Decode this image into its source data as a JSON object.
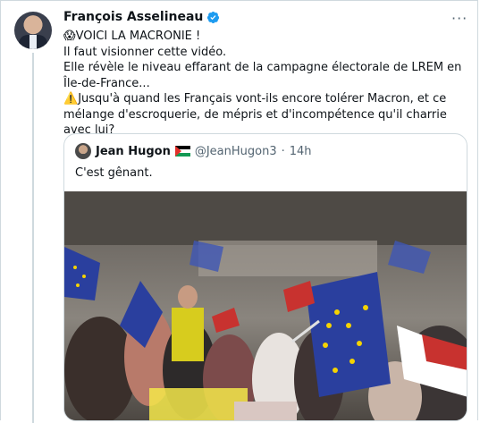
{
  "tweet": {
    "author_name": "François Asselineau",
    "more_icon": "···",
    "emoji_scream": "😱",
    "line1": "VOICI LA MACRONIE !",
    "line2": "Il faut visionner cette vidéo.",
    "line3": "Elle révèle le niveau effarant de la campagne électorale de LREM en Île-de-France...",
    "warning_emoji": "⚠️",
    "line4": "Jusqu'à quand les Français vont-ils encore tolérer Macron, et ce mélange d'escroquerie, de mépris et d'incompétence qu'il charrie avec lui?"
  },
  "quote": {
    "name": "Jean Hugon",
    "handle": "@JeanHugon3",
    "dot": "·",
    "time": "14h",
    "text": "C'est gênant."
  },
  "colors": {
    "verified": "#1d9bf0",
    "secondary_text": "#536471",
    "border": "#cfd9de",
    "eu_blue": "#2a3f9e",
    "eu_star": "#f5d300"
  }
}
